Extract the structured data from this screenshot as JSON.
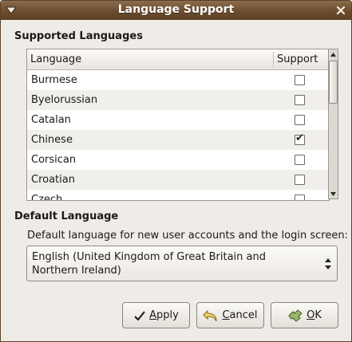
{
  "window": {
    "title": "Language Support"
  },
  "supported": {
    "section_title": "Supported Languages",
    "columns": {
      "language": "Language",
      "support": "Support"
    },
    "rows": [
      {
        "label": "Burmese",
        "checked": false
      },
      {
        "label": "Byelorussian",
        "checked": false
      },
      {
        "label": "Catalan",
        "checked": false
      },
      {
        "label": "Chinese",
        "checked": true
      },
      {
        "label": "Corsican",
        "checked": false
      },
      {
        "label": "Croatian",
        "checked": false
      },
      {
        "label": "Czech",
        "checked": false
      }
    ]
  },
  "default_language": {
    "section_title": "Default Language",
    "description": "Default language for new user accounts and the login screen:",
    "selected": "English (United Kingdom of Great Britain and Northern Ireland)"
  },
  "buttons": {
    "apply": "Apply",
    "cancel": "Cancel",
    "ok": "OK"
  },
  "colors": {
    "titlebar": "#6b4c2e",
    "window_bg": "#efebe7"
  }
}
